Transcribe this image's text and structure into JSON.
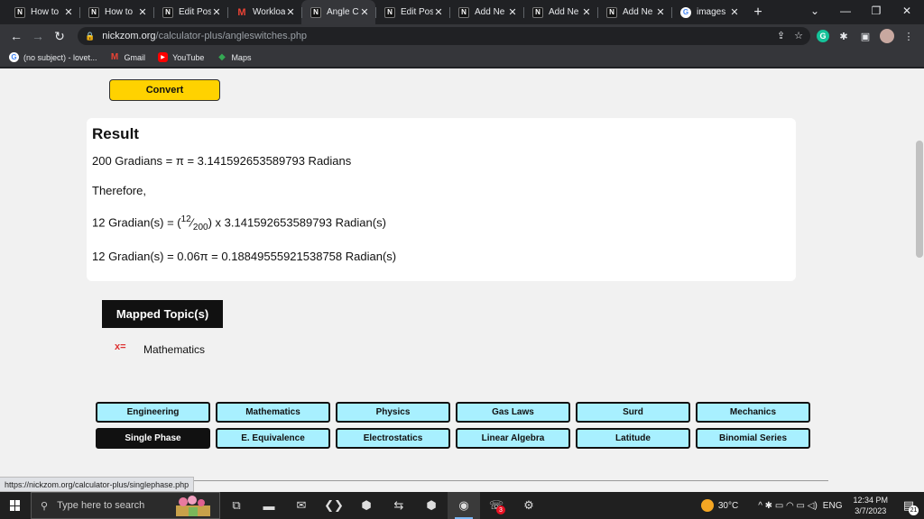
{
  "browser": {
    "tabs": [
      {
        "label": "How to",
        "icon": "nz",
        "active": false
      },
      {
        "label": "How to",
        "icon": "nz",
        "active": false
      },
      {
        "label": "Edit Post",
        "icon": "nz",
        "active": false
      },
      {
        "label": "Workload",
        "icon": "gm",
        "active": false
      },
      {
        "label": "Angle Co",
        "icon": "nz",
        "active": true
      },
      {
        "label": "Edit Post",
        "icon": "nz",
        "active": false
      },
      {
        "label": "Add Ne",
        "icon": "nz",
        "active": false
      },
      {
        "label": "Add Ne",
        "icon": "nz",
        "active": false
      },
      {
        "label": "Add Ne",
        "icon": "nz",
        "active": false
      },
      {
        "label": "images",
        "icon": "gg",
        "active": false
      }
    ],
    "favicon_nz_glyph": "N",
    "favicon_gm_glyph": "M",
    "favicon_gg_glyph": "G",
    "close_glyph": "✕",
    "new_tab_glyph": "+",
    "url_host": "nickzom.org",
    "url_path": "/calculator-plus/angleswitches.php",
    "window_controls": [
      "⌄",
      "—",
      "❐",
      "✕"
    ],
    "nav": {
      "back": "←",
      "forward": "→",
      "reload": "↻"
    },
    "omni_icons": [
      "⇪",
      "☆"
    ],
    "lock_glyph": "🔒",
    "extensions": {
      "grammarly": "G",
      "puzzle": "✱",
      "sidebar": "▣",
      "menu": "⋮"
    },
    "bookmarks": [
      {
        "label": "(no subject) - lovet...",
        "icon": "g",
        "glyph": "G"
      },
      {
        "label": "Gmail",
        "icon": "m",
        "glyph": "M"
      },
      {
        "label": "YouTube",
        "icon": "yt",
        "glyph": "▶"
      },
      {
        "label": "Maps",
        "icon": "maps",
        "glyph": "◆"
      }
    ],
    "status_url": "https://nickzom.org/calculator-plus/singlephase.php"
  },
  "page": {
    "convert_label": "Convert",
    "result": {
      "title": "Result",
      "line1": "200 Gradians = π = 3.141592653589793 Radians",
      "therefore": "Therefore,",
      "line3_prefix": "12 Gradian(s) = (",
      "line3_num": "12",
      "line3_slash": "⁄",
      "line3_den": "200",
      "line3_suffix": ") x 3.141592653589793 Radian(s)",
      "line4": "12 Gradian(s) = 0.06π = 0.18849555921538758 Radian(s)"
    },
    "mapped_title": "Mapped Topic(s)",
    "topic_icon_glyph": "x=",
    "topic": "Mathematics",
    "categories": [
      {
        "label": "Engineering",
        "dark": false
      },
      {
        "label": "Mathematics",
        "dark": false
      },
      {
        "label": "Physics",
        "dark": false
      },
      {
        "label": "Gas Laws",
        "dark": false
      },
      {
        "label": "Surd",
        "dark": false
      },
      {
        "label": "Mechanics",
        "dark": false
      },
      {
        "label": "Single Phase",
        "dark": true
      },
      {
        "label": "E. Equivalence",
        "dark": false
      },
      {
        "label": "Electrostatics",
        "dark": false
      },
      {
        "label": "Linear Algebra",
        "dark": false
      },
      {
        "label": "Latitude",
        "dark": false
      },
      {
        "label": "Binomial Series",
        "dark": false
      }
    ]
  },
  "taskbar": {
    "search_placeholder": "Type here to search",
    "search_glyph": "⚲",
    "apps": [
      {
        "name": "task-view-icon",
        "glyph": "⧉",
        "active": false
      },
      {
        "name": "file-explorer-icon",
        "glyph": "▬",
        "active": false
      },
      {
        "name": "mail-icon",
        "glyph": "✉",
        "active": false
      },
      {
        "name": "vscode-icon",
        "glyph": "❮❯",
        "active": false
      },
      {
        "name": "app-hexagon-icon",
        "glyph": "⬢",
        "active": false
      },
      {
        "name": "teamviewer-icon",
        "glyph": "⇆",
        "active": false
      },
      {
        "name": "app-green-hexagon-icon",
        "glyph": "⬢",
        "active": false
      },
      {
        "name": "chrome-icon",
        "glyph": "◉",
        "active": true
      },
      {
        "name": "whatsapp-icon",
        "glyph": "☏",
        "active": false,
        "badge": "3"
      },
      {
        "name": "settings-icon",
        "glyph": "⚙",
        "active": false
      }
    ],
    "weather": "30°C",
    "tray_glyphs": "^ ✱ ▭ ◠ ▭ ◁)",
    "lang": "ENG",
    "time": "12:34 PM",
    "date": "3/7/2023",
    "notif_glyph": "▤",
    "notif_count": "21"
  },
  "colors": {
    "accent_button": "#ffd200",
    "category_bg": "#a8f0ff",
    "page_bg": "#f1f1f1"
  }
}
